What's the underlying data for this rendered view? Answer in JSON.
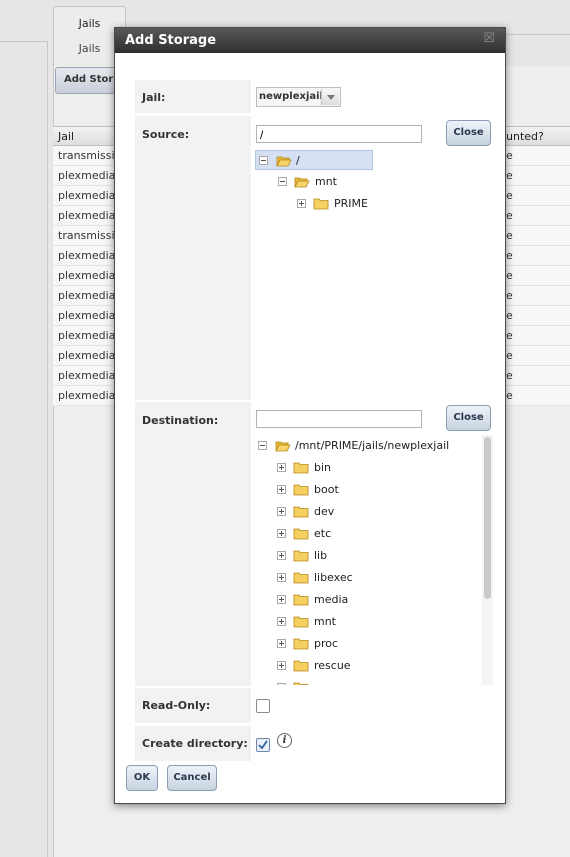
{
  "background": {
    "tabs": [
      "Jails",
      "Jails"
    ],
    "add_button": "Add Stora",
    "grid": {
      "columns": [
        "Jail",
        "unted?"
      ],
      "rows": [
        {
          "jail": "transmissi",
          "mounted": "e"
        },
        {
          "jail": "plexmedia",
          "mounted": "e"
        },
        {
          "jail": "plexmedia",
          "mounted": "e"
        },
        {
          "jail": "plexmedia",
          "mounted": "e"
        },
        {
          "jail": "transmissi",
          "mounted": "e"
        },
        {
          "jail": "plexmedia",
          "mounted": "e"
        },
        {
          "jail": "plexmedia",
          "mounted": "e"
        },
        {
          "jail": "plexmedia",
          "mounted": "e"
        },
        {
          "jail": "plexmedia",
          "mounted": "e"
        },
        {
          "jail": "plexmedia",
          "mounted": "e"
        },
        {
          "jail": "plexmedia",
          "mounted": "e"
        },
        {
          "jail": "plexmedia",
          "mounted": "e"
        },
        {
          "jail": "plexmedia",
          "mounted": "e"
        }
      ]
    }
  },
  "dialog": {
    "title": "Add Storage",
    "close_glyph": "☒",
    "fields": {
      "jail_label": "Jail:",
      "jail_value": "newplexjail",
      "source_label": "Source:",
      "source_value": "/",
      "source_close": "Close",
      "destination_label": "Destination:",
      "destination_value": "",
      "destination_close": "Close",
      "readonly_label": "Read-Only:",
      "readonly_checked": false,
      "create_dir_label": "Create directory:",
      "create_dir_checked": true
    },
    "source_tree": [
      {
        "label": "/",
        "expanded": true,
        "selected": true
      },
      {
        "label": "mnt",
        "expanded": true
      },
      {
        "label": "PRIME",
        "expanded": false
      }
    ],
    "destination_tree": {
      "root": "/mnt/PRIME/jails/newplexjail",
      "children": [
        "bin",
        "boot",
        "dev",
        "etc",
        "lib",
        "libexec",
        "media",
        "mnt",
        "proc",
        "rescue"
      ]
    },
    "buttons": {
      "ok": "OK",
      "cancel": "Cancel"
    },
    "info_glyph": "i"
  },
  "colors": {
    "title_bar": "#3a3a3a",
    "button_border": "#8e9db3",
    "selected_row": "#d5e1f2",
    "folder": "#f1c54a"
  }
}
